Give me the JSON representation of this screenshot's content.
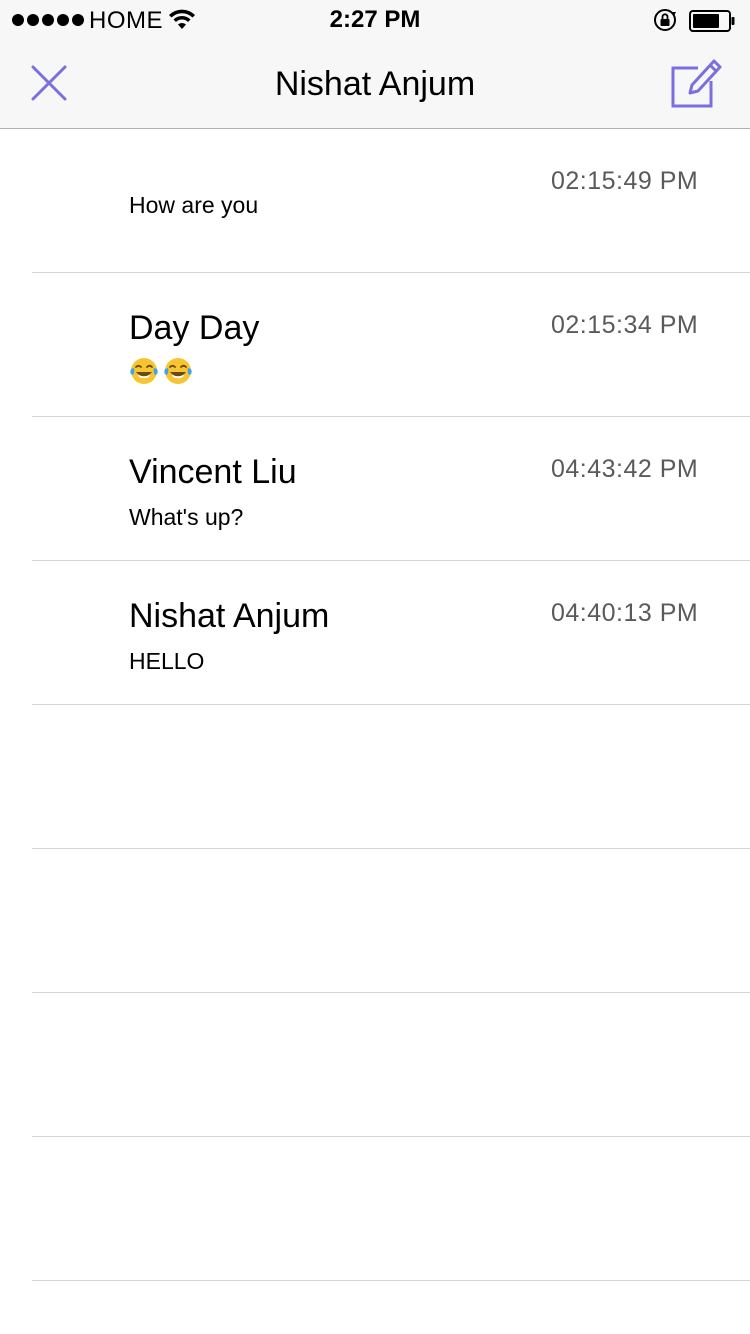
{
  "status_bar": {
    "carrier": "HOME",
    "time": "2:27 PM"
  },
  "nav": {
    "title": "Nishat Anjum"
  },
  "messages": [
    {
      "name": "",
      "message": "How are you",
      "time": "02:15:49 PM"
    },
    {
      "name": "Day Day",
      "message": "😂😂",
      "time": "02:15:34 PM"
    },
    {
      "name": "Vincent Liu",
      "message": "What's up?",
      "time": "04:43:42 PM"
    },
    {
      "name": "Nishat Anjum",
      "message": "HELLO",
      "time": "04:40:13 PM"
    }
  ],
  "colors": {
    "accent": "#7b6fe0",
    "separator": "#d4d4d4",
    "nav_background": "#f7f7f7",
    "timestamp": "#5a5a5a"
  },
  "icons": {
    "close": "close-icon",
    "compose": "compose-icon"
  }
}
